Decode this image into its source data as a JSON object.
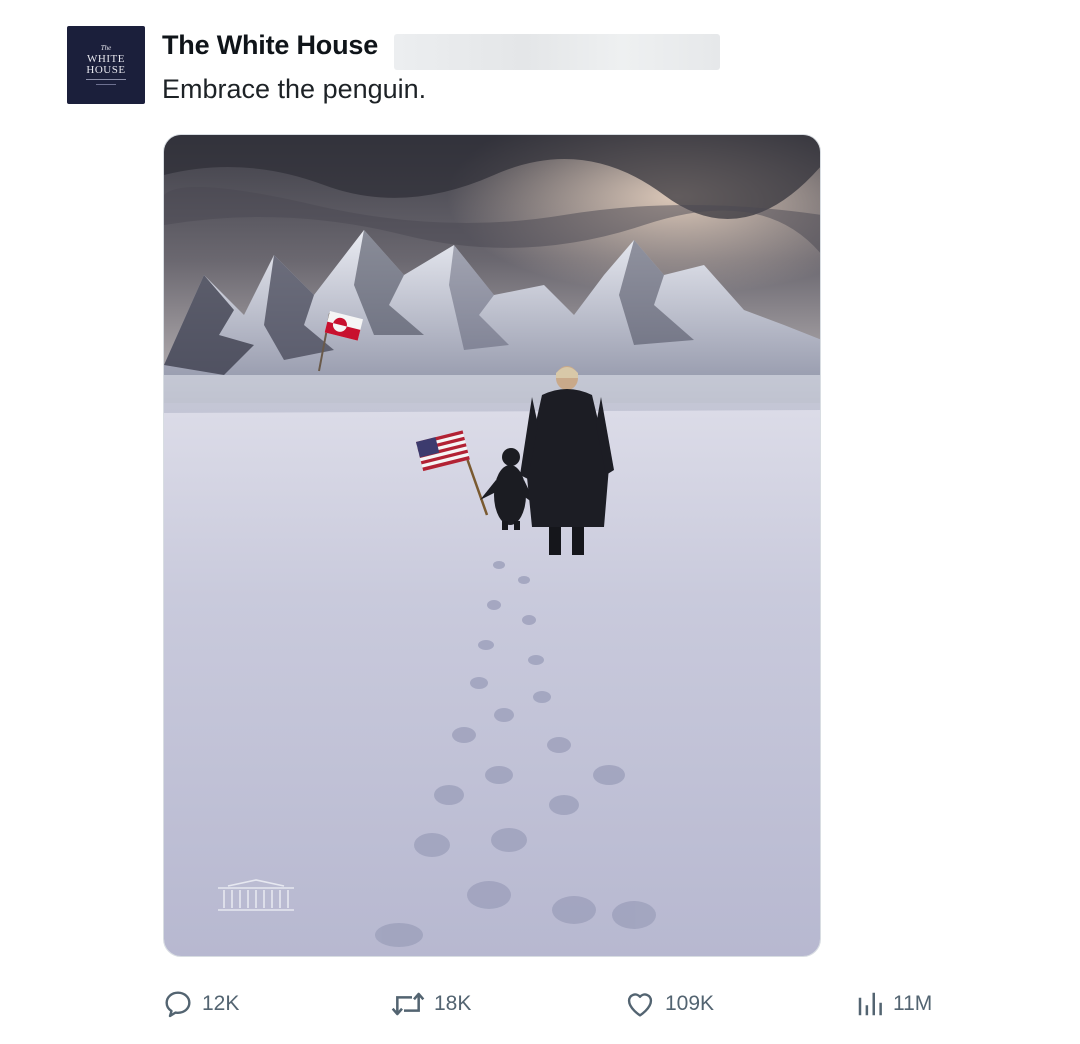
{
  "account": {
    "display_name": "The White House",
    "avatar_text": {
      "line1": "The",
      "line2": "WHITE",
      "line3": "HOUSE"
    }
  },
  "tweet": {
    "text": "Embrace the penguin."
  },
  "media": {
    "description_icon": "white-house-watermark-icon"
  },
  "actions": {
    "reply_count": "12K",
    "repost_count": "18K",
    "like_count": "109K",
    "view_count": "11M"
  },
  "colors": {
    "action_gray": "#536471",
    "avatar_navy": "#1b1f3b",
    "text_dark": "#0f1419"
  }
}
